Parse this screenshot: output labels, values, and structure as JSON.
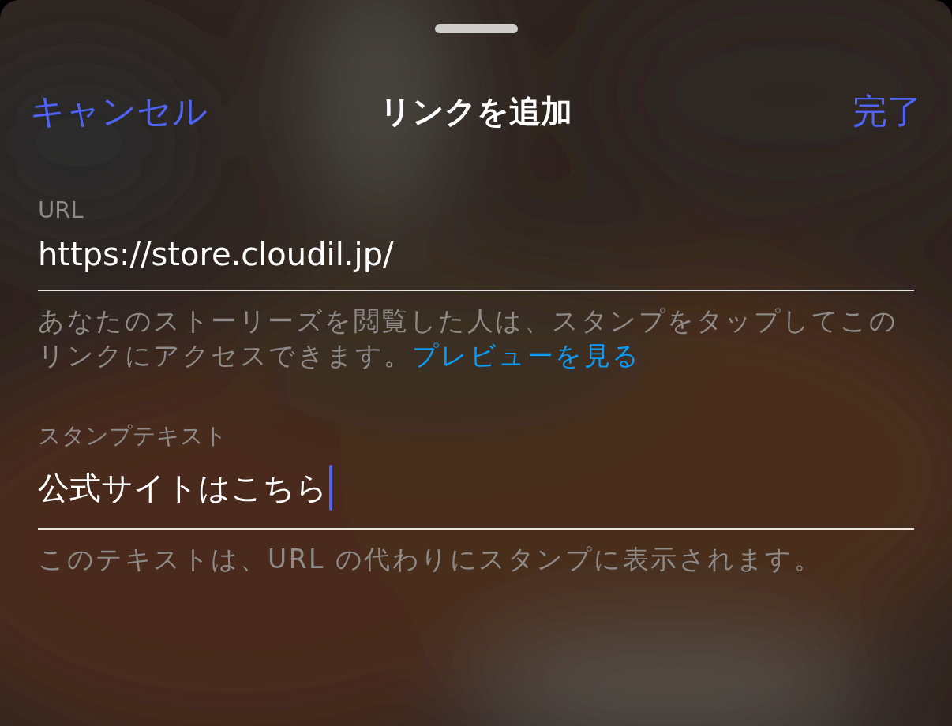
{
  "header": {
    "cancel": "キャンセル",
    "title": "リンクを追加",
    "done": "完了"
  },
  "fields": [
    {
      "label": "URL",
      "value": "https://store.cloudil.jp/",
      "focused": false,
      "help": "あなたのストーリーズを閲覧した人は、スタンプをタップしてこのリンクにアクセスできます。",
      "help_link": "プレビューを見る"
    },
    {
      "label": "スタンプテキスト",
      "value": "公式サイトはこちら",
      "focused": true,
      "help": "このテキストは、URL の代わりにスタンプに表示されます。"
    }
  ]
}
